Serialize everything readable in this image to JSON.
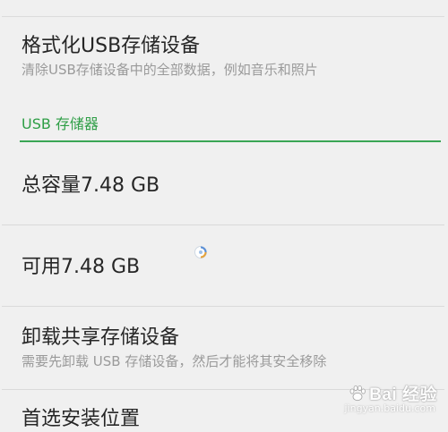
{
  "settings_list": {
    "format_usb": {
      "title": "格式化USB存储设备",
      "subtitle": "清除USB存储设备中的全部数据，例如音乐和照片"
    },
    "section_header": "USB 存储器",
    "total_capacity": {
      "title": "总容量7.48 GB"
    },
    "available": {
      "title": "可用7.48 GB"
    },
    "unmount": {
      "title": "卸载共享存储设备",
      "subtitle": "需要先卸载 USB 存储设备，然后才能将其安全移除"
    },
    "install_location": {
      "title": "首选安装位置"
    }
  },
  "loading_indicator": {
    "icon": "loading-spinner-icon"
  },
  "watermark": {
    "logo_text": "Bai 经验",
    "url_text": "jingyan.baidu.com"
  },
  "colors": {
    "background": "#f0f0f0",
    "accent_green": "#3aa655",
    "title_text": "#262626",
    "subtitle_text": "#9a9a9a",
    "divider": "#dadada"
  }
}
